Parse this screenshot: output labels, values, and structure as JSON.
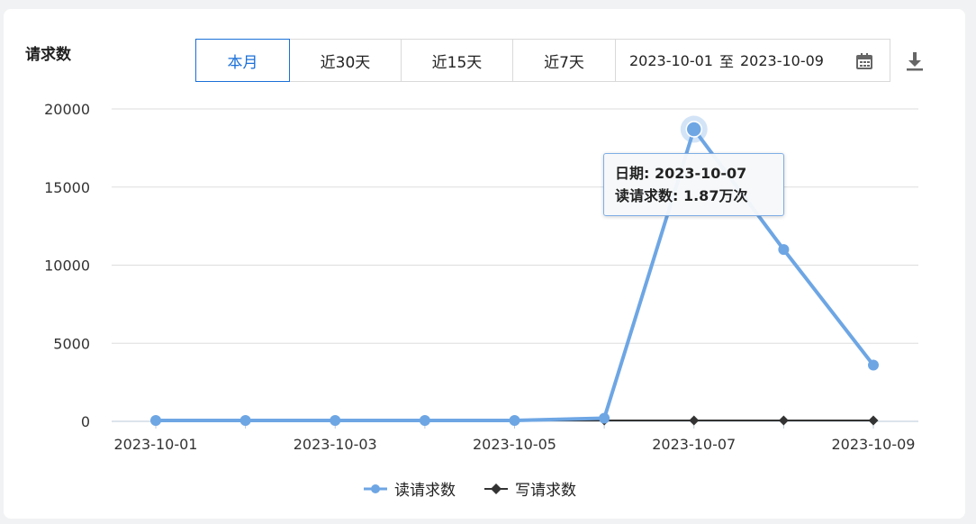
{
  "header": {
    "title": "请求数",
    "ranges": [
      {
        "label": "本月",
        "active": true
      },
      {
        "label": "近30天",
        "active": false
      },
      {
        "label": "近15天",
        "active": false
      },
      {
        "label": "近7天",
        "active": false
      }
    ],
    "date_start": "2023-10-01",
    "date_sep": "至",
    "date_end": "2023-10-09"
  },
  "icons": {
    "calendar": "calendar-icon",
    "download": "download-icon"
  },
  "tooltip": {
    "line1": "日期: 2023-10-07",
    "line2": "读请求数: 1.87万次"
  },
  "colors": {
    "read": "#6ea6e4",
    "write": "#333333",
    "grid": "#dddddd",
    "accent": "#1a6fd8"
  },
  "chart_data": {
    "type": "line",
    "x": [
      "2023-10-01",
      "2023-10-02",
      "2023-10-03",
      "2023-10-04",
      "2023-10-05",
      "2023-10-06",
      "2023-10-07",
      "2023-10-08",
      "2023-10-09"
    ],
    "xticks": [
      "2023-10-01",
      "2023-10-03",
      "2023-10-05",
      "2023-10-07",
      "2023-10-09"
    ],
    "yticks": [
      "20000",
      "15000",
      "10000",
      "5000",
      "0"
    ],
    "ylim": [
      0,
      20000
    ],
    "grid": true,
    "legend": "bottom",
    "highlight_index": 6,
    "series": [
      {
        "name": "读请求数",
        "marker": "circle",
        "values": [
          60,
          60,
          60,
          60,
          60,
          200,
          18700,
          11000,
          3600
        ]
      },
      {
        "name": "写请求数",
        "marker": "diamond",
        "values": [
          60,
          60,
          60,
          60,
          60,
          60,
          60,
          60,
          60
        ]
      }
    ]
  }
}
